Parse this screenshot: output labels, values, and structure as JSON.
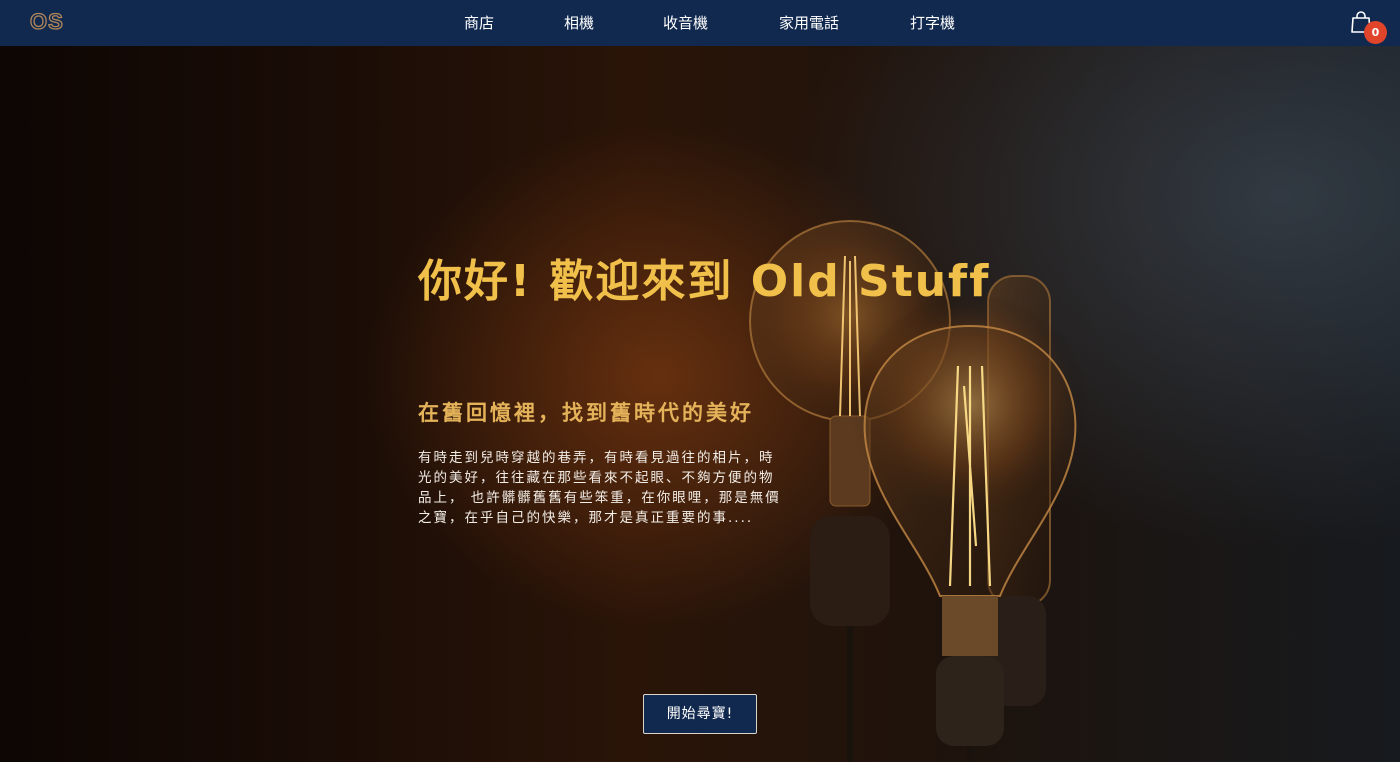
{
  "header": {
    "logo": "OS",
    "nav": [
      "商店",
      "相機",
      "收音機",
      "家用電話",
      "打字機"
    ],
    "cart_count": "0"
  },
  "hero": {
    "title": "你好! 歡迎來到 Old Stuff",
    "subtitle": "在舊回憶裡，找到舊時代的美好",
    "body_lines": [
      "有時走到兒時穿越的巷弄，有時看見過往的相片，時",
      "光的美好，往往藏在那些看來不起眼、不夠方便的物",
      "品上， 也許髒髒舊舊有些笨重，在你眼哩，那是無價",
      "之寶，在乎自己的快樂，那才是真正重要的事...."
    ],
    "cta_label": "開始尋寶!"
  },
  "colors": {
    "navbar": "#11294f",
    "title": "#f0c04a",
    "subtitle": "#e3b259",
    "badge": "#e0452b"
  },
  "icons": {
    "cart": "shopping-bag-icon"
  }
}
